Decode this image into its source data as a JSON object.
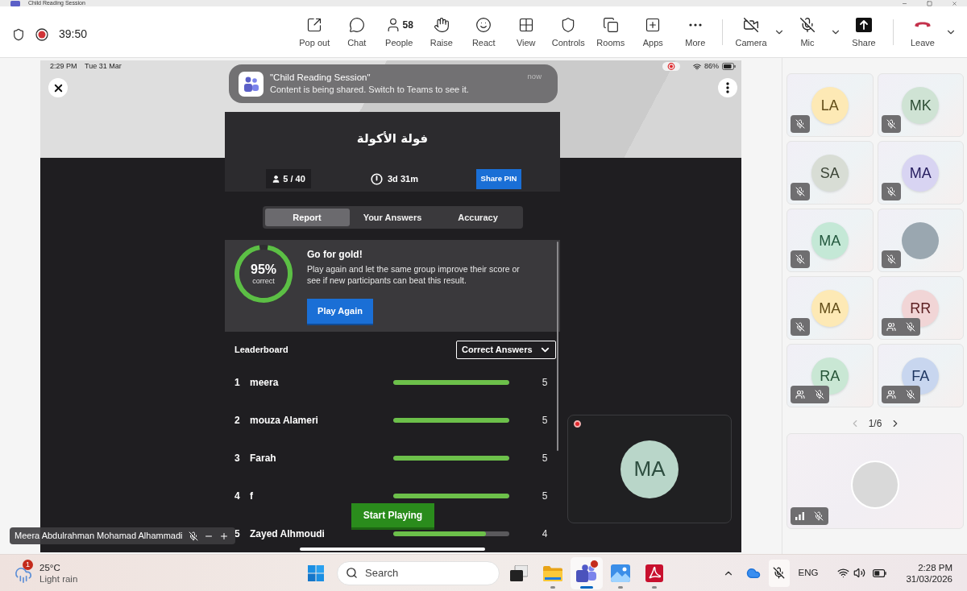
{
  "window": {
    "title": "Child Reading Session"
  },
  "meeting_bar": {
    "recording": true,
    "timer": "39:50",
    "actions": [
      {
        "kind": "popout",
        "label": "Pop out"
      },
      {
        "kind": "chat",
        "label": "Chat"
      },
      {
        "kind": "people",
        "label": "People",
        "count": "58"
      },
      {
        "kind": "raise",
        "label": "Raise"
      },
      {
        "kind": "react",
        "label": "React"
      },
      {
        "kind": "view",
        "label": "View"
      },
      {
        "kind": "controls",
        "label": "Controls"
      },
      {
        "kind": "rooms",
        "label": "Rooms"
      },
      {
        "kind": "apps",
        "label": "Apps"
      },
      {
        "kind": "more",
        "label": "More"
      }
    ],
    "devices": [
      {
        "kind": "camera",
        "label": "Camera",
        "on": false
      },
      {
        "kind": "mic",
        "label": "Mic",
        "on": false
      },
      {
        "kind": "share",
        "label": "Share"
      }
    ],
    "leave": {
      "label": "Leave"
    }
  },
  "shared_screen": {
    "status_bar": {
      "time": "2:29 PM",
      "date": "Tue 31 Mar",
      "screen_recording": true,
      "battery": "86%"
    },
    "notification": {
      "title": "\"Child Reading Session\"",
      "message": "Content is being shared. Switch to Teams to see it.",
      "time": "now"
    },
    "quiz": {
      "title": "فولة الأكولة",
      "players": "5 / 40",
      "time_left": "3d 31m",
      "share_button": "Share PIN"
    },
    "tabs": [
      {
        "label": "Report",
        "selected": true
      },
      {
        "label": "Your Answers",
        "selected": false
      },
      {
        "label": "Accuracy",
        "selected": false
      }
    ],
    "report": {
      "score": "95%",
      "score_caption": "correct",
      "level": 0.95,
      "heading": "Go for gold!",
      "text": "Play again and let the same group improve their score or see if new participants can beat this result.",
      "button": "Play Again"
    },
    "leaderboard": {
      "title": "Leaderboard",
      "sort": "Correct Answers",
      "rows": [
        {
          "rank": "1",
          "name": "meera",
          "level": 1,
          "value": "5"
        },
        {
          "rank": "2",
          "name": "mouza Alameri",
          "level": 1,
          "value": "5"
        },
        {
          "rank": "3",
          "name": "Farah",
          "level": 1,
          "value": "5"
        },
        {
          "rank": "4",
          "name": "f",
          "level": 1,
          "value": "5"
        },
        {
          "rank": "5",
          "name": "Zayed Alhmoudi",
          "level": 0.8,
          "value": "4"
        }
      ]
    },
    "start_button": "Start Playing"
  },
  "presenter": {
    "name": "Meera Abdulrahman Mohamad Alhammadi",
    "muted": true
  },
  "self_view": {
    "initials": "MA",
    "color": "#b9d6c9",
    "recording": true
  },
  "participants": {
    "tiles": [
      {
        "kind": "initials",
        "initials": "LA",
        "color": "#fde9b5",
        "muted": true,
        "unverified": false
      },
      {
        "kind": "initials",
        "initials": "MK",
        "color": "#cfe3d4",
        "muted": true,
        "unverified": false
      },
      {
        "kind": "initials",
        "initials": "SA",
        "color": "#d8ddd5",
        "muted": true,
        "unverified": false
      },
      {
        "kind": "initials",
        "initials": "MA",
        "color": "#d8d4f2",
        "muted": true,
        "unverified": false
      },
      {
        "kind": "initials",
        "initials": "MA",
        "color": "#c4e8d6",
        "muted": true,
        "unverified": false
      },
      {
        "kind": "photo",
        "muted": true,
        "unverified": false
      },
      {
        "kind": "initials",
        "initials": "MA",
        "color": "#fde9b5",
        "muted": true,
        "unverified": false
      },
      {
        "kind": "initials",
        "initials": "RR",
        "color": "#f1d5d6",
        "muted": true,
        "unverified": true
      },
      {
        "kind": "initials",
        "initials": "RA",
        "color": "#c9e7d4",
        "muted": true,
        "unverified": true
      },
      {
        "kind": "initials",
        "initials": "FA",
        "color": "#c8d6ef",
        "muted": true,
        "unverified": true
      }
    ],
    "pager": {
      "label": "1/6",
      "previous_enabled": false,
      "next_enabled": true
    },
    "spotlight": {
      "kind": "photo",
      "muted": true
    }
  },
  "taskbar": {
    "weather": {
      "badge": "1",
      "temperature": "25°C",
      "condition": "Light rain"
    },
    "search": {
      "placeholder": "Search"
    },
    "apps": [
      {
        "kind": "task_view",
        "running": false,
        "selected": false,
        "alert": false
      },
      {
        "kind": "file_explorer",
        "running": true,
        "selected": false,
        "alert": false
      },
      {
        "kind": "teams",
        "running": true,
        "selected": true,
        "alert": true
      },
      {
        "kind": "photos",
        "running": true,
        "selected": false,
        "alert": false
      },
      {
        "kind": "pdf_reader",
        "running": true,
        "selected": false,
        "alert": false
      }
    ],
    "tray": {
      "mic_muted": true,
      "language": "ENG",
      "time": "2:28 PM",
      "date": "31/03/2026"
    }
  }
}
